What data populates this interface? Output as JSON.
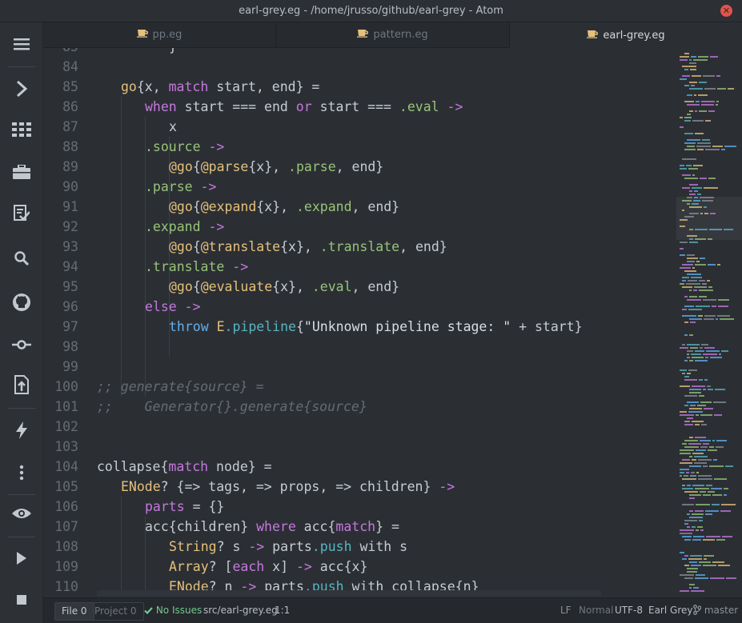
{
  "window": {
    "title": "earl-grey.eg - /home/jrusso/github/earl-grey - Atom",
    "close_glyph": "✕"
  },
  "sidebar": {
    "items": [
      "menu-icon",
      "chevron-right-icon",
      "apps-grid-icon",
      "briefcase-icon",
      "checklist-icon",
      "search-icon",
      "github-icon",
      "git-commit-icon",
      "upload-file-icon",
      "lightning-icon",
      "more-vertical-icon",
      "eye-icon",
      "play-icon",
      "stop-icon"
    ]
  },
  "tabs": [
    {
      "label": "pp.eg",
      "active": false
    },
    {
      "label": "pattern.eg",
      "active": false
    },
    {
      "label": "earl-grey.eg",
      "active": true
    }
  ],
  "editor": {
    "lines": [
      {
        "n": "85"
      },
      {
        "n": "84"
      },
      {
        "n": "85"
      },
      {
        "n": "86"
      },
      {
        "n": "87"
      },
      {
        "n": "88"
      },
      {
        "n": "89"
      },
      {
        "n": "90"
      },
      {
        "n": "91"
      },
      {
        "n": "92"
      },
      {
        "n": "93"
      },
      {
        "n": "94"
      },
      {
        "n": "95"
      },
      {
        "n": "96"
      },
      {
        "n": "97"
      },
      {
        "n": "98"
      },
      {
        "n": "99"
      },
      {
        "n": "100"
      },
      {
        "n": "101"
      },
      {
        "n": "102"
      },
      {
        "n": "103"
      },
      {
        "n": "104"
      },
      {
        "n": "105"
      },
      {
        "n": "106"
      },
      {
        "n": "107"
      },
      {
        "n": "108"
      },
      {
        "n": "109"
      },
      {
        "n": "110"
      }
    ],
    "code": {
      "l0": "}",
      "l2_fn": "go",
      "l2_a": "{x, ",
      "l2_kw": "match",
      "l2_b": " start, end} =",
      "l3_kw1": "when",
      "l3_a": " start === end ",
      "l3_kw2": "or",
      "l3_b": " start === ",
      "l3_sym": ".eval",
      "l3_op": " ->",
      "l4": "x",
      "l5_sym": ".source",
      "l5_op": " ->",
      "l6_fn": "@go",
      "l6_a": "{",
      "l6_fn2": "@parse",
      "l6_b": "{x}, ",
      "l6_sym": ".parse",
      "l6_c": ", end}",
      "l7_sym": ".parse",
      "l7_op": " ->",
      "l8_fn": "@go",
      "l8_a": "{",
      "l8_fn2": "@expand",
      "l8_b": "{x}, ",
      "l8_sym": ".expand",
      "l8_c": ", end}",
      "l9_sym": ".expand",
      "l9_op": " ->",
      "l10_fn": "@go",
      "l10_a": "{",
      "l10_fn2": "@translate",
      "l10_b": "{x}, ",
      "l10_sym": ".translate",
      "l10_c": ", end}",
      "l11_sym": ".translate",
      "l11_op": " ->",
      "l12_fn": "@go",
      "l12_a": "{",
      "l12_fn2": "@evaluate",
      "l12_b": "{x}, ",
      "l12_sym": ".eval",
      "l12_c": ", end}",
      "l13_kw": "else",
      "l13_op": " ->",
      "l14_kw": "throw",
      "l14_sp": " ",
      "l14_fn": "E",
      "l14_teal": ".pipeline",
      "l14_a": "{",
      "l14_str": "\"Unknown pipeline stage: \"",
      "l14_b": " + start}",
      "l17": ";; generate{source} =",
      "l18": ";;    Generator{}.generate{source}",
      "l21_a": "collapse{",
      "l21_kw": "match",
      "l21_b": " node} =",
      "l22_fn": "ENode",
      "l22_a": "? {=> tags, => props, => children} ",
      "l22_op": "->",
      "l23_kw": "parts",
      "l23_a": " = {}",
      "l24_a": "acc{children} ",
      "l24_kw": "where",
      "l24_b": " acc{",
      "l24_kw2": "match",
      "l24_c": "} =",
      "l25_fn": "String",
      "l25_a": "? s ",
      "l25_op": "->",
      "l25_b": " parts",
      "l25_teal": ".push",
      "l25_c": " with s",
      "l26_fn": "Array",
      "l26_a": "? [",
      "l26_kw": "each",
      "l26_b": " x] ",
      "l26_op": "->",
      "l26_c": " acc{x}",
      "l27_fn": "ENode",
      "l27_a": "? n ",
      "l27_op": "->",
      "l27_b": " parts",
      "l27_teal": ".push",
      "l27_c": " with collapse{n}"
    }
  },
  "status_bar": {
    "file_label": "File",
    "file_count": "0",
    "project_label": "Project",
    "project_count": "0",
    "no_issues": "No Issues",
    "file_path": "src/earl-grey.eg",
    "cursor": "1:1",
    "line_ending": "LF",
    "mode": "Normal",
    "encoding": "UTF-8",
    "grammar": "Earl Grey",
    "branch": "master"
  },
  "colors": {
    "keyword": "#c678dd",
    "function": "#e5c07b",
    "symbol": "#98c379",
    "comment": "#656b72",
    "accent": "#61afef"
  }
}
